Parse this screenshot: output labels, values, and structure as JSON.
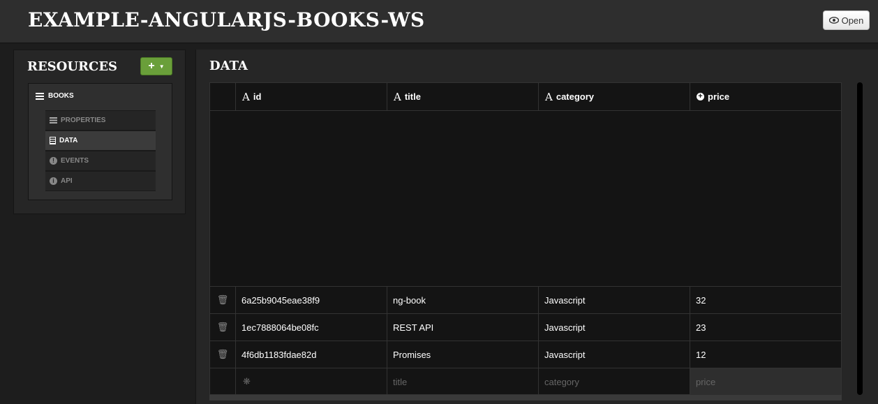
{
  "header": {
    "title": "EXAMPLE-ANGULARJS-BOOKS-WS",
    "open_label": "Open"
  },
  "sidebar": {
    "title": "RESOURCES",
    "add_label": "+",
    "root_label": "BOOKS",
    "items": [
      {
        "label": "PROPERTIES",
        "icon": "list-icon"
      },
      {
        "label": "DATA",
        "icon": "document-icon"
      },
      {
        "label": "EVENTS",
        "icon": "alert-icon"
      },
      {
        "label": "API",
        "icon": "info-icon"
      }
    ]
  },
  "main": {
    "title": "DATA",
    "columns": [
      {
        "label": "id",
        "type_icon": "A"
      },
      {
        "label": "title",
        "type_icon": "A"
      },
      {
        "label": "category",
        "type_icon": "A"
      },
      {
        "label": "price",
        "type_icon": "+"
      }
    ],
    "rows": [
      {
        "id": "6a25b9045eae38f9",
        "title": "ng-book",
        "category": "Javascript",
        "price": "32"
      },
      {
        "id": "1ec7888064be08fc",
        "title": "REST API",
        "category": "Javascript",
        "price": "23"
      },
      {
        "id": "4f6db1183fdae82d",
        "title": "Promises",
        "category": "Javascript",
        "price": "12"
      }
    ],
    "new_row": {
      "id_marker": "❋",
      "title_placeholder": "title",
      "category_placeholder": "category",
      "price_placeholder": "price"
    }
  }
}
